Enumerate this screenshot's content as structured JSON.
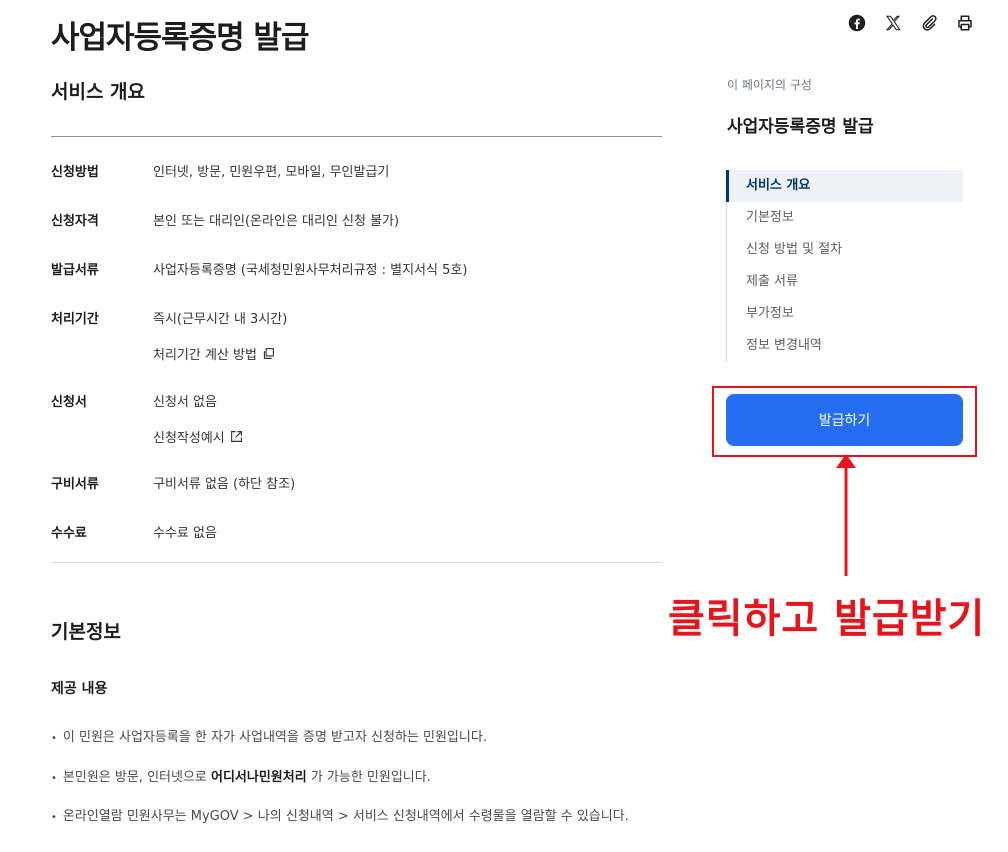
{
  "page": {
    "title": "사업자등록증명 발급"
  },
  "share": {
    "icons": [
      "facebook-icon",
      "x-icon",
      "link-icon",
      "print-icon"
    ]
  },
  "overview": {
    "title": "서비스 개요",
    "rows": [
      {
        "label": "신청방법",
        "values": [
          "인터넷, 방문, 민원우편, 모바일, 무인발급기"
        ]
      },
      {
        "label": "신청자격",
        "values": [
          "본인 또는 대리인(온라인은 대리인 신청 불가)"
        ]
      },
      {
        "label": "발급서류",
        "values": [
          "사업자등록증명 (국세청민원사무처리규정 : 별지서식 5호)"
        ]
      },
      {
        "label": "처리기간",
        "values": [
          "즉시(근무시간 내 3시간)",
          "처리기간 계산 방법"
        ]
      },
      {
        "label": "신청서",
        "values": [
          "신청서 없음",
          "신청작성예시"
        ]
      },
      {
        "label": "구비서류",
        "values": [
          "구비서류 없음 (하단 참조)"
        ]
      },
      {
        "label": "수수료",
        "values": [
          "수수료 없음"
        ]
      }
    ]
  },
  "basic": {
    "title": "기본정보",
    "subtitle": "제공 내용",
    "bullets": [
      {
        "text": "이 민원은 사업자등록을 한 자가 사업내역을 증명 받고자 신청하는 민원입니다."
      },
      {
        "pre": "본민원은 방문, 인터넷으로 ",
        "bold": "어디서나민원처리",
        "post": " 가 가능한 민원입니다."
      },
      {
        "text": "온라인열람 민원사무는 MyGOV > 나의 신청내역 > 서비스 신청내역에서 수령물을 열람할 수 있습니다."
      }
    ]
  },
  "toc": {
    "caption": "이 페이지의 구성",
    "title": "사업자등록증명 발급",
    "items": [
      "서비스 개요",
      "기본정보",
      "신청 방법 및 절차",
      "제출 서류",
      "부가정보",
      "정보 변경내역"
    ],
    "active_index": 0
  },
  "action": {
    "issue_label": "발급하기",
    "color": "#256ef4"
  },
  "annotation": {
    "text": "클릭하고 발급받기",
    "color": "#e8141c"
  }
}
